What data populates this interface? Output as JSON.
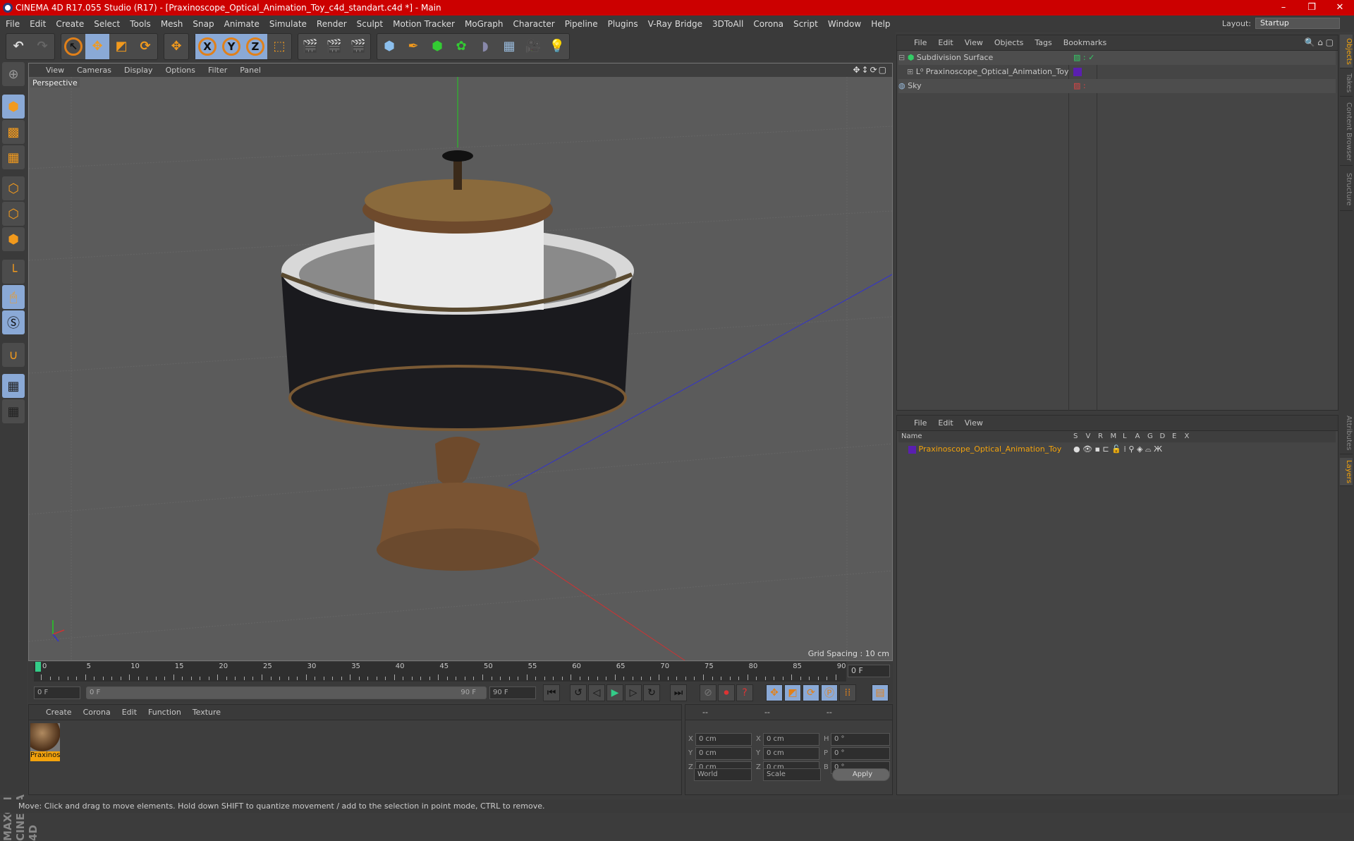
{
  "title": "CINEMA 4D R17.055 Studio (R17) - [Praxinoscope_Optical_Animation_Toy_c4d_standart.c4d *] - Main",
  "menu": [
    "File",
    "Edit",
    "Create",
    "Select",
    "Tools",
    "Mesh",
    "Snap",
    "Animate",
    "Simulate",
    "Render",
    "Sculpt",
    "Motion Tracker",
    "MoGraph",
    "Character",
    "Pipeline",
    "Plugins",
    "V-Ray Bridge",
    "3DToAll",
    "Corona",
    "Script",
    "Window",
    "Help"
  ],
  "layout": {
    "label": "Layout:",
    "value": "Startup"
  },
  "toolbar": {
    "axis": [
      "X",
      "Y",
      "Z"
    ]
  },
  "viewport": {
    "menu": [
      "View",
      "Cameras",
      "Display",
      "Options",
      "Filter",
      "Panel"
    ],
    "label": "Perspective",
    "grid_spacing": "Grid Spacing : 10 cm"
  },
  "timeline": {
    "ticks": [
      "0",
      "5",
      "10",
      "15",
      "20",
      "25",
      "30",
      "35",
      "40",
      "45",
      "50",
      "55",
      "60",
      "65",
      "70",
      "75",
      "80",
      "85",
      "90"
    ],
    "current": "0 F",
    "start": "0 F",
    "range_start": "0 F",
    "range_end": "90 F",
    "end": "90 F"
  },
  "material": {
    "menu": [
      "Create",
      "Corona",
      "Edit",
      "Function",
      "Texture"
    ],
    "items": [
      {
        "name": "Praxinos"
      }
    ]
  },
  "coords": {
    "headers": [
      "--",
      "--",
      "--"
    ],
    "rows": [
      {
        "a": "X",
        "av": "0 cm",
        "b": "X",
        "bv": "0 cm",
        "c": "H",
        "cv": "0 °"
      },
      {
        "a": "Y",
        "av": "0 cm",
        "b": "Y",
        "bv": "0 cm",
        "c": "P",
        "cv": "0 °"
      },
      {
        "a": "Z",
        "av": "0 cm",
        "b": "Z",
        "bv": "0 cm",
        "c": "B",
        "cv": "0 °"
      }
    ],
    "world": "World",
    "scale": "Scale",
    "apply": "Apply"
  },
  "objects": {
    "menu": [
      "File",
      "Edit",
      "View",
      "Objects",
      "Tags",
      "Bookmarks"
    ],
    "items": [
      {
        "name": "Subdivision Surface"
      },
      {
        "name": "Praxinoscope_Optical_Animation_Toy"
      },
      {
        "name": "Sky"
      }
    ]
  },
  "layers": {
    "menu": [
      "File",
      "Edit",
      "View"
    ],
    "columns": [
      "Name",
      "S",
      "V",
      "R",
      "M",
      "L",
      "A",
      "G",
      "D",
      "E",
      "X"
    ],
    "items": [
      {
        "name": "Praxinoscope_Optical_Animation_Toy",
        "color": "#5a1fb0"
      }
    ]
  },
  "right_tabs": [
    "Objects",
    "Takes",
    "Content Browser",
    "Structure",
    "Attributes",
    "Layers"
  ],
  "brand": "MAXON CINEMA 4D",
  "status": "Move: Click and drag to move elements. Hold down SHIFT to quantize movement / add to the selection in point mode, CTRL to remove.",
  "colors": {
    "title_bar": "#cc0000",
    "accent": "#f29a1d",
    "selected": "#8aa9d6"
  }
}
